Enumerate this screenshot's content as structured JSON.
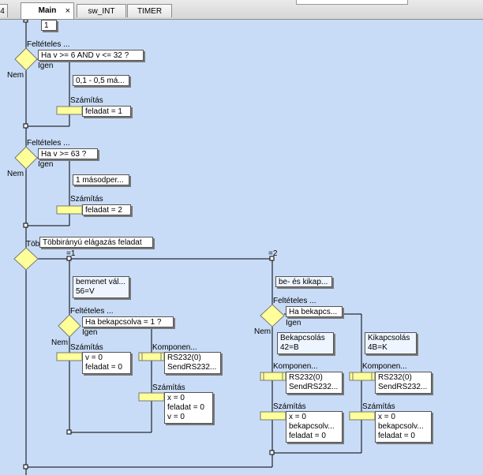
{
  "tabs": [
    {
      "label": "4",
      "active": false
    },
    {
      "label": "Main",
      "active": true
    },
    {
      "label": "sw_INT",
      "active": false
    },
    {
      "label": "TIMER",
      "active": false
    }
  ],
  "tab_close_glyph": "×",
  "colors": {
    "canvas": "#c9dcf7",
    "block_fill": "#ffff99",
    "line": "#000000"
  },
  "blocks": {
    "top_value": "1",
    "cond1": {
      "title": "Feltételes ...",
      "question": "Ha v >= 6 AND v <= 32 ?",
      "yes": "Igen",
      "no": "Nem",
      "comment": "0,1 - 0,5 má...",
      "calc_title": "Számítás",
      "calc_text": "feladat = 1"
    },
    "cond2": {
      "title": "Feltételes ...",
      "question": "Ha v >= 63 ?",
      "yes": "Igen",
      "no": "Nem",
      "comment": "1 másodper...",
      "calc_title": "Számítás",
      "calc_text": "feladat = 2"
    },
    "multi": {
      "title": "Töb",
      "question": "Többirányú elágazás feladat",
      "case1": "=1",
      "case2": "=2"
    },
    "left_branch": {
      "comment": [
        "bemenet vál...",
        "56=V"
      ],
      "cond_title": "Feltételes ...",
      "cond_question": "Ha bekapcsolva = 1 ?",
      "yes": "Igen",
      "no": "Nem",
      "calc1_title": "Számítás",
      "calc1_lines": [
        "v = 0",
        "feladat = 0"
      ],
      "comp_title": "Komponen...",
      "comp_lines": [
        "RS232(0)",
        "SendRS232..."
      ],
      "calc2_title": "Számítás",
      "calc2_lines": [
        "x = 0",
        "feladat = 0",
        "v = 0"
      ]
    },
    "right_branch": {
      "comment": "be- és kikap...",
      "cond_title": "Feltételes ...",
      "cond_question": "Ha bekapcs...",
      "yes": "Igen",
      "no": "Nem",
      "no_comment": [
        "Bekapcsolás",
        "42=B"
      ],
      "yes_comment": [
        "Kikapcsolás",
        "4B=K"
      ],
      "comp_a_title": "Komponen...",
      "comp_a_lines": [
        "RS232(0)",
        "SendRS232..."
      ],
      "comp_b_title": "Komponen...",
      "comp_b_lines": [
        "RS232(0)",
        "SendRS232..."
      ],
      "calc_a_title": "Számítás",
      "calc_a_lines": [
        "x = 0",
        "bekapcsolv...",
        "feladat = 0"
      ],
      "calc_b_title": "Számítás",
      "calc_b_lines": [
        "x = 0",
        "bekapcsolv...",
        "feladat = 0"
      ]
    }
  }
}
